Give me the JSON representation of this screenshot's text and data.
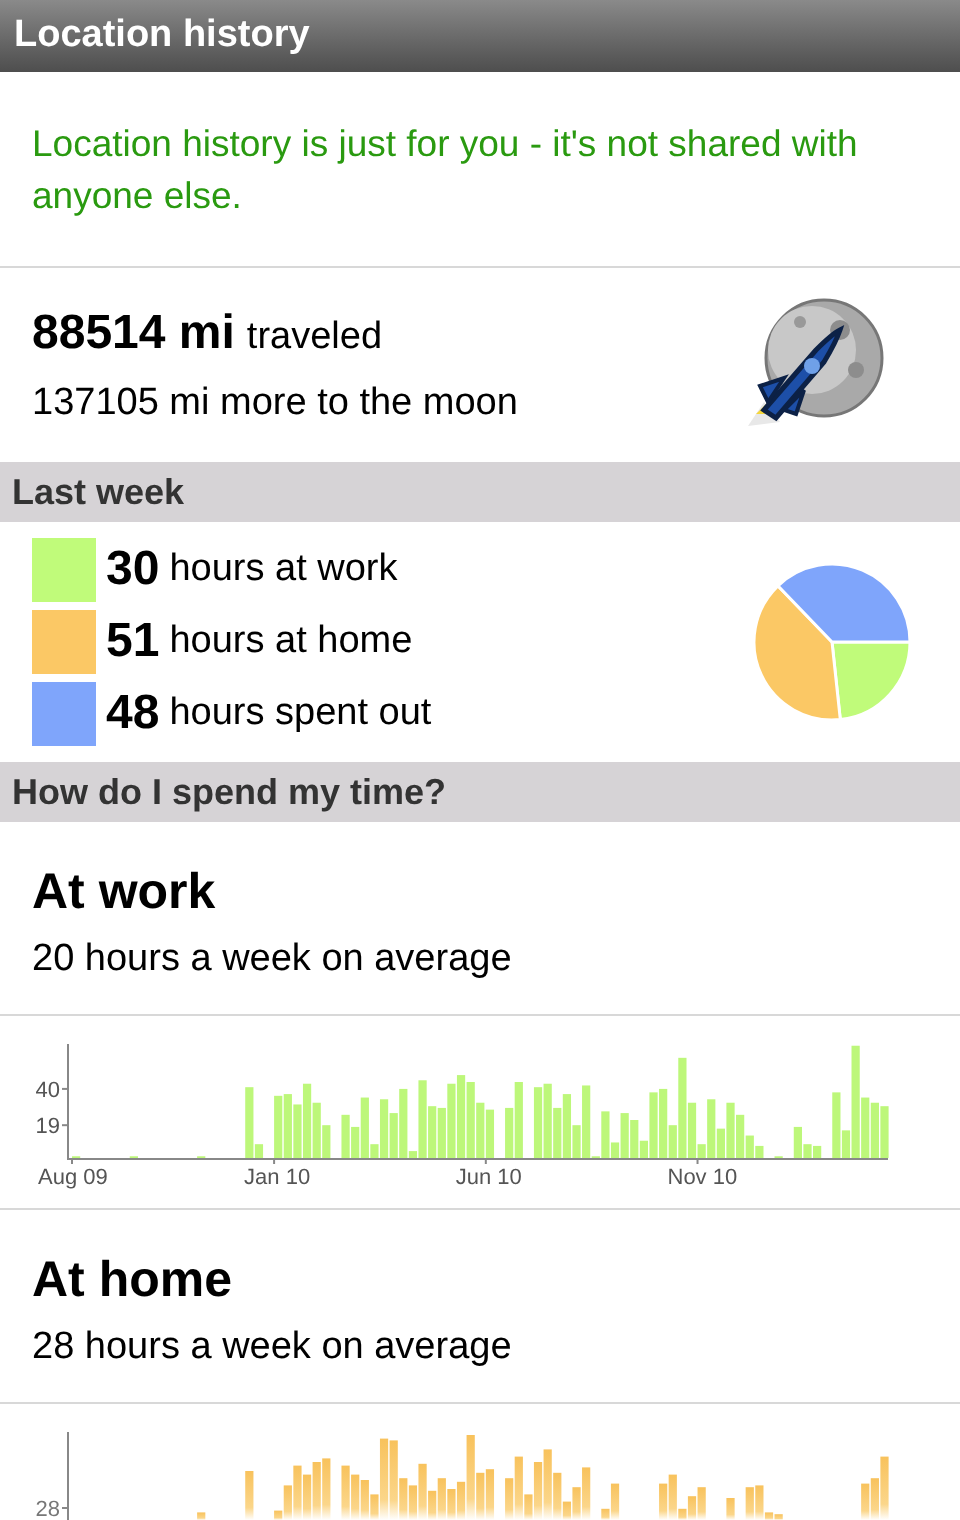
{
  "title_bar": {
    "title": "Location history"
  },
  "privacy_note": "Location history is just for you - it's not shared with anyone else.",
  "distance": {
    "value": "88514 mi",
    "value_note": "traveled",
    "moon_note": "137105 mi more to the moon"
  },
  "last_week": {
    "heading": "Last week",
    "items": [
      {
        "number": "30",
        "label": "hours at work",
        "color": "#c0fb7a"
      },
      {
        "number": "51",
        "label": "hours at home",
        "color": "#fbc865"
      },
      {
        "number": "48",
        "label": "hours spent out",
        "color": "#7fa5fb"
      }
    ],
    "chart_data": {
      "type": "pie",
      "values": [
        23.3,
        39.5,
        37.2
      ]
    }
  },
  "time_section": {
    "heading": "How do I spend my time?",
    "places": [
      {
        "title": "At work",
        "average": "20 hours a week on average",
        "chart_data": {
          "type": "bar",
          "categories": [
            "Aug 09",
            null,
            null,
            null,
            null,
            null,
            null,
            null,
            null,
            null,
            null,
            null,
            null,
            null,
            null,
            null,
            null,
            null,
            null,
            null,
            null,
            "Jan 10",
            null,
            null,
            null,
            null,
            null,
            null,
            null,
            null,
            null,
            null,
            null,
            null,
            null,
            null,
            null,
            null,
            null,
            null,
            null,
            null,
            null,
            "Jun 10",
            null,
            null,
            null,
            null,
            null,
            null,
            null,
            null,
            null,
            null,
            null,
            null,
            null,
            null,
            null,
            null,
            null,
            null,
            null,
            null,
            null,
            "Nov 10",
            null,
            null,
            null,
            null,
            null,
            null,
            null,
            null,
            null,
            null,
            null,
            null,
            null,
            null,
            null,
            null,
            null,
            null,
            null
          ],
          "series": [
            {
              "color": "#bdf77a",
              "values": [
                1,
                0,
                0,
                0,
                0,
                0,
                1,
                0,
                0,
                0,
                0,
                0,
                0,
                1,
                0,
                0,
                0,
                0,
                41,
                8,
                0,
                36,
                37,
                31,
                43,
                32,
                19,
                0,
                25,
                18,
                35,
                8,
                34,
                26,
                40,
                4,
                45,
                30,
                29,
                43,
                48,
                44,
                32,
                28,
                0,
                29,
                44,
                0,
                41,
                43,
                29,
                37,
                19,
                42,
                1,
                27,
                9,
                26,
                22,
                10,
                38,
                40,
                19,
                58,
                32,
                8,
                34,
                17,
                32,
                25,
                13,
                7,
                0,
                1,
                0,
                18,
                8,
                7,
                0,
                38,
                16,
                65,
                35,
                32,
                30
              ]
            }
          ],
          "ylim": [
            0,
            66
          ],
          "yticks": [
            19,
            40
          ]
        }
      },
      {
        "title": "At home",
        "average": "28 hours a week on average",
        "ytick_label": "28"
      }
    ]
  }
}
